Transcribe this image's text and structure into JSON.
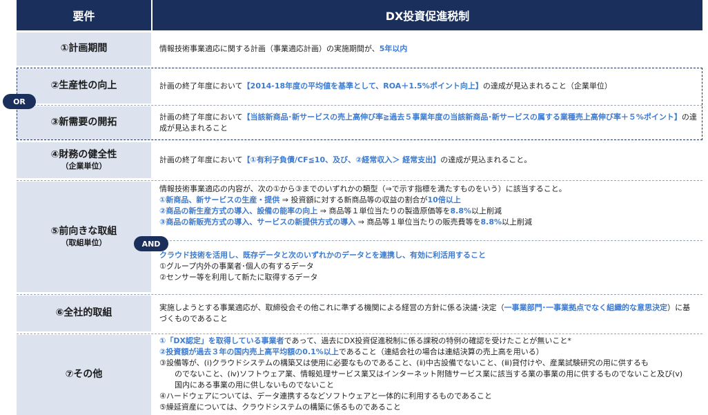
{
  "header": {
    "left": "要件",
    "right": "DX投資促進税制"
  },
  "badges": {
    "or": "OR",
    "and": "AND"
  },
  "rows": {
    "plan": {
      "label": "①計画期間",
      "t1": "情報技術事業適応に関する計画（事業適応計画）の実施期間が、",
      "h1": "5年以内"
    },
    "prod": {
      "label": "②生産性の向上",
      "t1": "計画の終了年度において",
      "h1": "【2014-18年度の平均値を基準として、ROA＋1.5%ポイント向上】",
      "t2": "の達成が見込まれること（企業単位）"
    },
    "demand": {
      "label": "③新需要の開拓",
      "t1": "計画の終了年度において",
      "h1": "【当該新商品･新サービスの売上高伸び率≧過去５事業年度の当該新商品･新サービスの属する業種売上高伸び率＋５%ポイント】",
      "t2": "の達成が見込まれること"
    },
    "fin": {
      "label": "④財務の健全性",
      "sub": "（企業単位）",
      "t1": "計画の終了年度において",
      "h1": "【①有利子負債/CF≦10、及び、②経常収入＞ 経常支出】",
      "t2": "の達成が見込まれること。"
    },
    "forward": {
      "label": "⑤前向きな取組",
      "sub": "（取組単位）",
      "intro": "情報技術事業適応の内容が、次の①から③までのいずれかの類型（⇒で示す指標を満たすものをいう）に該当すること。",
      "i1h": "①新商品、新サービスの生産・提供",
      "i1t": " ⇒ 投資額に対する新商品等の収益の割合が",
      "i1h2": "10倍以上",
      "i2h": "②商品の新生産方式の導入、設備の能率の向上",
      "i2t": " ⇒ 商品等１単位当たりの製造原価等を",
      "i2h2": "8.8%",
      "i2t2": "以上削減",
      "i3h": "③商品の新販売方式の導入、サービスの新提供方式の導入",
      "i3t": " ⇒ 商品等１単位当たりの販売費等を",
      "i3h2": "8.8%",
      "i3t2": "以上削減",
      "cloud": "クラウド技術を活用し、既存データと次のいずれかのデータとを連携し、有効に利活用すること",
      "c1": "①グループ内外の事業者･個人の有するデータ",
      "c2": "②センサー等を利用して新たに取得するデータ"
    },
    "company": {
      "label": "⑥全社的取組",
      "t1": "実施しようとする事業適応が、取締役会その他これに準ずる機関による経営の方針に係る決議･決定（",
      "h1": "一事業部門･一事業拠点でなく組織的な意思決定",
      "t2": "）に基づくものであること"
    },
    "other": {
      "label": "⑦その他",
      "o1h": "①「DX認定」を取得している事業者",
      "o1t": "であって、過去にDX投資促進税制に係る課税の特例の確認を受けたことが無いこと*",
      "o2h": "②投資額が過去３年の国内売上高平均額の0.1%以上",
      "o2t": "であること（連結会社の場合は連結決算の売上高を用いる）",
      "o3a": "③設備等が、(ⅰ)クラウドシステムの構築又は使用に必要なものであること、(ⅱ)中古設備でないこと、(ⅲ)貸付けや、産業試験研究の用に供するも",
      "o3b": "のでないこと、(ⅳ)ソフトウェア業、情報処理サービス業又はインターネット附随サービス業に該当する業の事業の用に供するものでないこと及び(ⅴ)",
      "o3c": "国内にある事業の用に供しないものでないこと",
      "o4": "④ハードウェアについては、データ連携するなどソフトウェアと一体的に利用するものであること",
      "o5": "⑤繰延資産については、クラウドシステムの構築に係るものであること"
    }
  }
}
